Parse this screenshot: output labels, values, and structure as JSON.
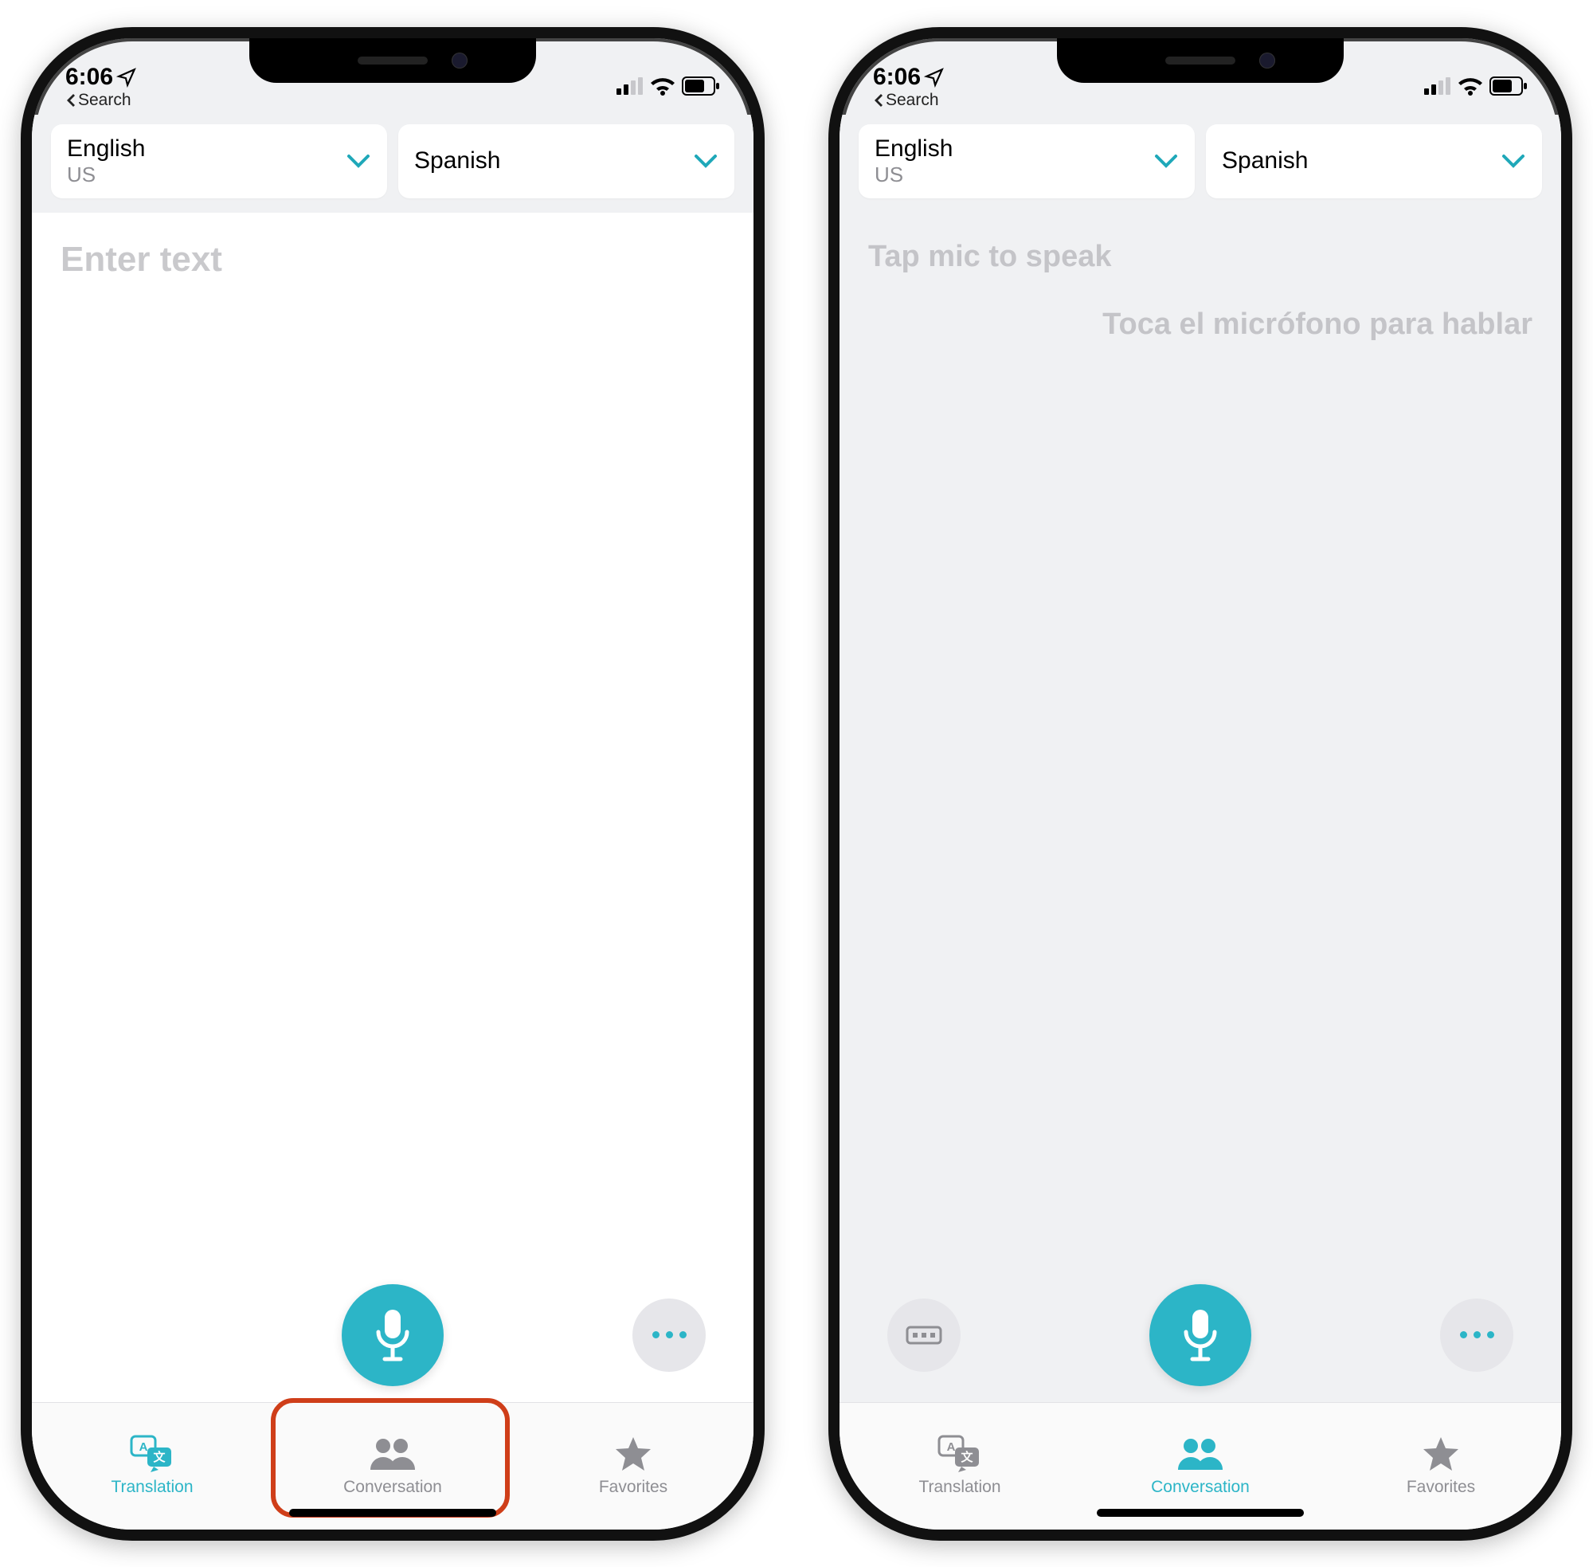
{
  "status": {
    "time": "6:06",
    "back_label": "Search"
  },
  "languages": {
    "source": {
      "name": "English",
      "region": "US"
    },
    "target": {
      "name": "Spanish",
      "region": ""
    }
  },
  "translation_screen": {
    "placeholder": "Enter text"
  },
  "conversation_screen": {
    "hint_source": "Tap mic to speak",
    "hint_target": "Toca el micrófono para hablar"
  },
  "tabs": {
    "translation": "Translation",
    "conversation": "Conversation",
    "favorites": "Favorites"
  }
}
